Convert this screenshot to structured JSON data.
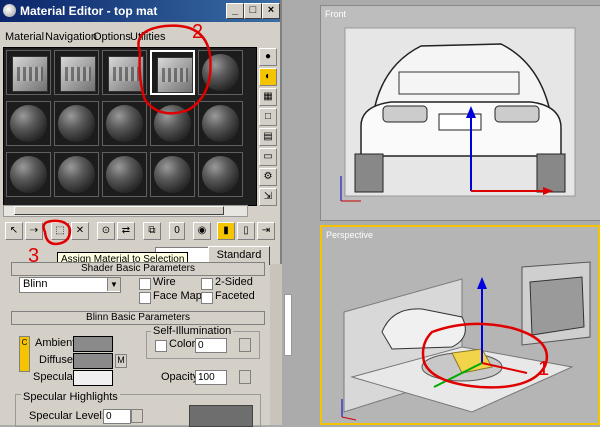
{
  "window": {
    "title": "Material Editor - top mat",
    "min": "_",
    "max": "□",
    "close": "×"
  },
  "menu": [
    "Material",
    "Navigation",
    "Options",
    "Utilities"
  ],
  "toolbar": {
    "mtl_id": "0",
    "tooltip": "Assign Material to Selection",
    "type_button": "Standard"
  },
  "shader_basic": {
    "header": "Shader Basic Parameters",
    "shader": "Blinn",
    "wire": "Wire",
    "two_sided": "2-Sided",
    "face_map": "Face Map",
    "faceted": "Faceted"
  },
  "blinn_basic": {
    "header": "Blinn Basic Parameters",
    "self_illum_group": "Self-Illumination",
    "ambient": "Ambient:",
    "diffuse": "Diffuse:",
    "specular": "Specular:",
    "color": "Color",
    "color_value": "0",
    "opacity": "Opacity:",
    "opacity_value": "100",
    "m": "M",
    "c": "C"
  },
  "spec_highlights": {
    "header": "Specular Highlights",
    "level": "Specular Level:",
    "level_value": "0"
  },
  "viewports": {
    "front": "Front",
    "perspective": "Perspective"
  },
  "annotations": [
    "2",
    "3",
    "1"
  ],
  "colors": {
    "title_blue": "#0a246a",
    "active_viewport": "#f5c400",
    "annotation_red": "#e00000"
  }
}
